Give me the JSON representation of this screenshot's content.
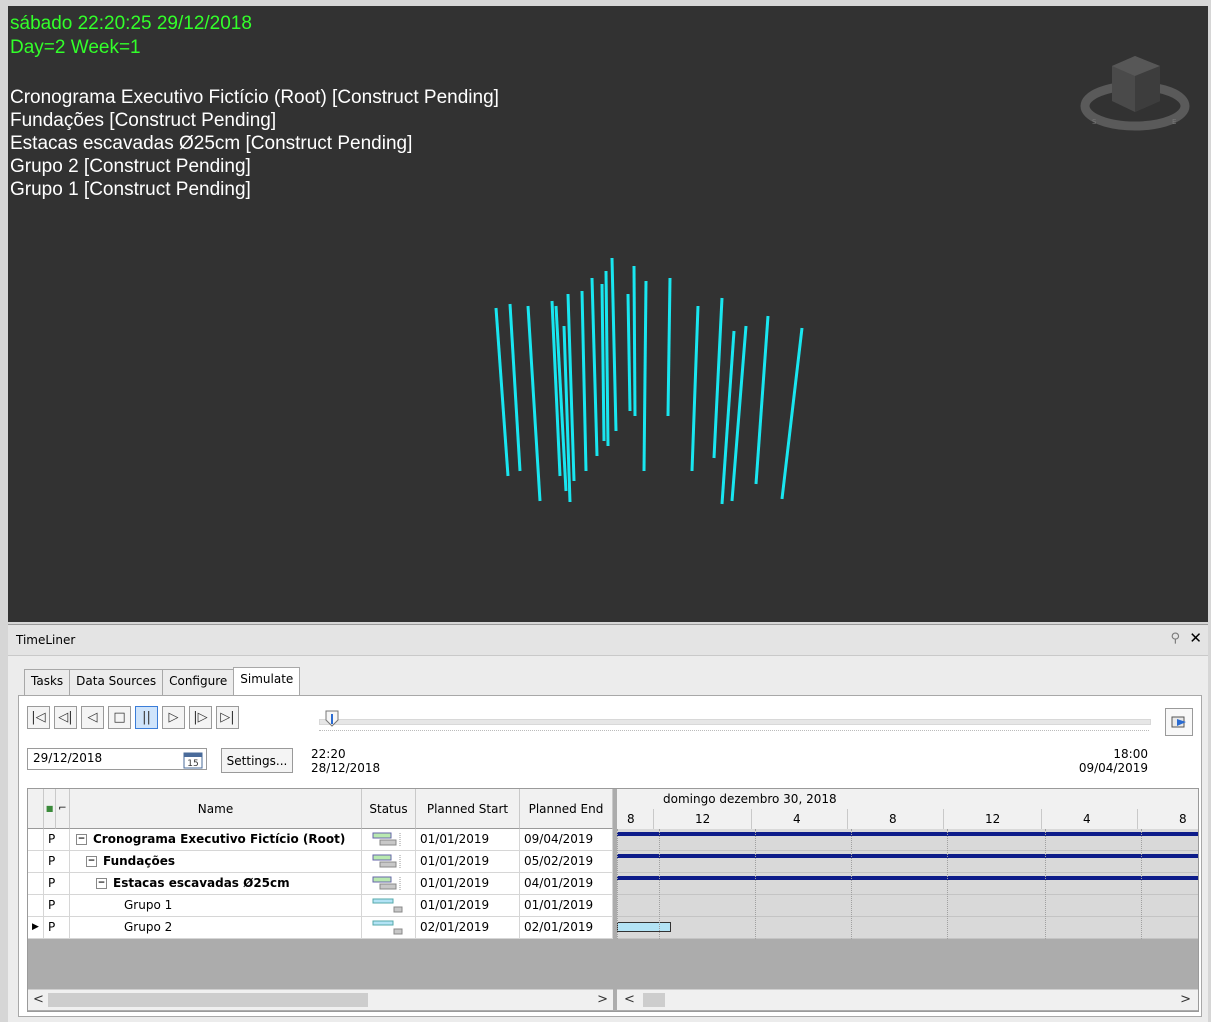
{
  "viewport": {
    "datetime": "sábado 22:20:25 29/12/2018",
    "day_week": "Day=2 Week=1",
    "active_tasks": [
      "Cronograma Executivo Fictício (Root) [Construct Pending]",
      "Fundações [Construct Pending]",
      "Estacas escavadas Ø25cm [Construct Pending]",
      "Grupo 2 [Construct Pending]",
      "Grupo 1 [Construct Pending]"
    ],
    "pile_color": "#19e6f0",
    "background_color": "#323232"
  },
  "panel": {
    "title": "TimeLiner",
    "pin_icon": "pin-icon",
    "close_icon": "close-icon"
  },
  "tabs": [
    "Tasks",
    "Data Sources",
    "Configure",
    "Simulate"
  ],
  "active_tab": "Simulate",
  "simulate": {
    "buttons": [
      "skip-to-start",
      "step-back",
      "play-backward",
      "stop",
      "pause",
      "play",
      "step-forward",
      "skip-to-end"
    ],
    "button_glyphs": [
      "|◁",
      "◁|",
      "◁",
      "□",
      "||",
      "▷",
      "|▷",
      "▷|"
    ],
    "date_value": "29/12/2018",
    "calendar_day": "15",
    "settings_label": "Settings...",
    "start_time": "22:20",
    "start_date": "28/12/2018",
    "end_time": "18:00",
    "end_date": "09/04/2019",
    "slider_position": 0.01
  },
  "grid": {
    "columns": [
      "Name",
      "Status",
      "Planned Start",
      "Planned End"
    ],
    "rows": [
      {
        "marker": "",
        "type": "P",
        "name": "Cronograma Executivo Fictício (Root)",
        "level": 0,
        "expander": "⊟",
        "bold": true,
        "start": "01/01/2019",
        "end": "09/04/2019"
      },
      {
        "marker": "",
        "type": "P",
        "name": "Fundações",
        "level": 1,
        "expander": "⊟",
        "bold": true,
        "start": "01/01/2019",
        "end": "05/02/2019"
      },
      {
        "marker": "",
        "type": "P",
        "name": "Estacas escavadas Ø25cm",
        "level": 2,
        "expander": "⊟",
        "bold": true,
        "start": "01/01/2019",
        "end": "04/01/2019"
      },
      {
        "marker": "",
        "type": "P",
        "name": "Grupo 1",
        "level": 3,
        "expander": "",
        "bold": false,
        "start": "01/01/2019",
        "end": "01/01/2019"
      },
      {
        "marker": "▶",
        "type": "P",
        "name": "Grupo 2",
        "level": 3,
        "expander": "",
        "bold": false,
        "start": "02/01/2019",
        "end": "02/01/2019"
      }
    ]
  },
  "gantt": {
    "date_header": "domingo dezembro 30, 2018",
    "hour_labels": [
      "8",
      "12",
      "4",
      "8",
      "12",
      "4",
      "8"
    ],
    "bar_color": "#0d1c8a"
  }
}
